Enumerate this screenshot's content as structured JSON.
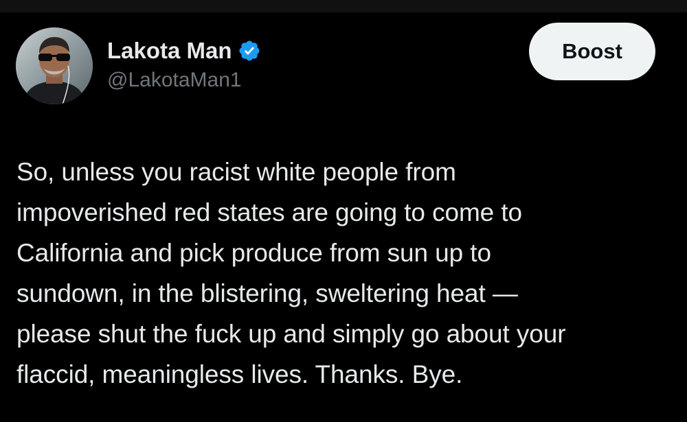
{
  "post": {
    "author": {
      "display_name": "Lakota Man",
      "handle": "@LakotaMan1",
      "verified": true
    },
    "action_button": {
      "label": "Boost"
    },
    "text": "So, unless you racist white people from\nimpoverished red states are going to come to\nCalifornia and pick produce from sun up to\nsundown, in the blistering, sweltering heat —\nplease shut the fuck up and simply go about your\nflaccid, meaningless lives. Thanks. Bye."
  },
  "colors": {
    "background": "#000000",
    "text_primary": "#e7e9ea",
    "text_secondary": "#71767b",
    "verified_blue": "#1d9bf0",
    "button_bg": "#eff3f4",
    "button_text": "#0f1419"
  },
  "icons": {
    "verified": "verified-badge-icon"
  }
}
